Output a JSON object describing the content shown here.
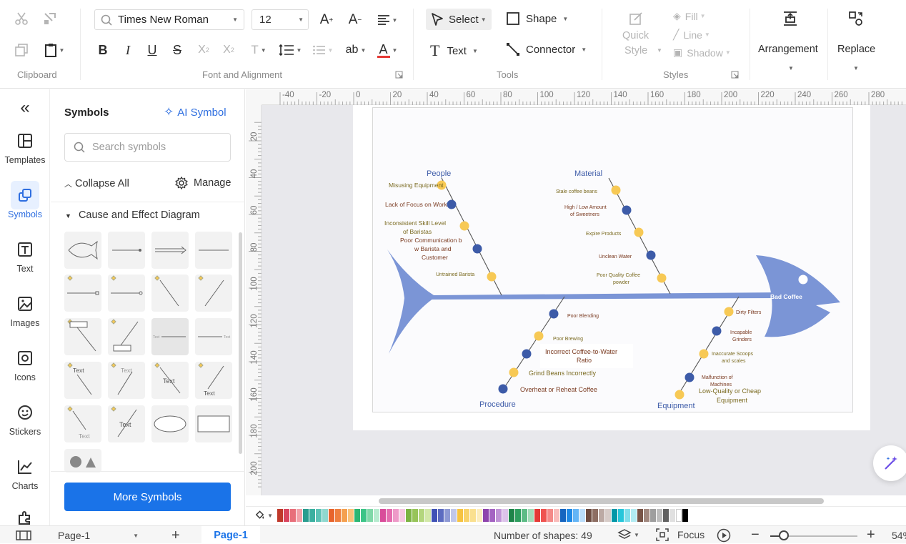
{
  "ribbon": {
    "font_name": "Times New Roman",
    "font_size": "12",
    "groups": {
      "clipboard": "Clipboard",
      "font_alignment": "Font and Alignment",
      "tools": "Tools",
      "styles": "Styles"
    },
    "tools": {
      "select": "Select",
      "shape": "Shape",
      "text": "Text",
      "connector": "Connector"
    },
    "styles": {
      "quick": "Quick",
      "style": "Style",
      "fill": "Fill",
      "line": "Line",
      "shadow": "Shadow"
    },
    "arrangement": "Arrangement",
    "replace": "Replace"
  },
  "rail": {
    "templates": "Templates",
    "symbols": "Symbols",
    "text": "Text",
    "images": "Images",
    "icons": "Icons",
    "stickers": "Stickers",
    "charts": "Charts"
  },
  "panel": {
    "title": "Symbols",
    "ai_symbol": "AI Symbol",
    "search_placeholder": "Search symbols",
    "collapse_all": "Collapse All",
    "manage": "Manage",
    "category": "Cause and Effect Diagram",
    "more_symbols": "More Symbols",
    "sym_text": "Text"
  },
  "rulers": {
    "h": [
      "-40",
      "-20",
      "0",
      "20",
      "40",
      "60",
      "80",
      "100",
      "120",
      "140",
      "160",
      "180",
      "200",
      "220",
      "240",
      "260",
      "280"
    ],
    "v": [
      "20",
      "40",
      "60",
      "80",
      "100",
      "120",
      "140",
      "160",
      "180",
      "200"
    ]
  },
  "diagram": {
    "head_label": "Bad Coffee",
    "categories": {
      "people": "People",
      "material": "Material",
      "procedure": "Procedure",
      "equipment": "Equipment"
    },
    "people_causes": [
      "Misusing Equipment",
      "Lack of Focus on Work",
      "Inconsistent Skill Level",
      "of Baristas",
      "Poor Communication b",
      "w Barista and",
      "Customer",
      "Untrained Barista"
    ],
    "material_causes": [
      "Stale coffee beans",
      "High / Low Amount",
      "of Sweetners",
      "Expire Products",
      "Unclean Water",
      "Poor Quality Coffee",
      "powder"
    ],
    "procedure_causes": [
      "Poor Blending",
      "Poor Brewing",
      "Incorrect Coffee-to-Water",
      "Ratio",
      "Grind Beans Incorrectly",
      "Overheat or Reheat Coffee"
    ],
    "equipment_causes": [
      "Dirty Filters",
      "Incapable",
      "Grinders",
      "Inaccurate Scoops",
      "and scales",
      "Malfunction  of",
      "Machines",
      "Low-Quality or Cheap",
      "Equipment"
    ]
  },
  "status": {
    "page_dropdown": "Page-1",
    "page_tab": "Page-1",
    "shapes": "Number of shapes: 49",
    "focus": "Focus",
    "zoom": "54%"
  },
  "colors": {
    "accent": "#1a73e8",
    "fish": "#7b95d6",
    "dot_yellow": "#f7c955",
    "dot_blue": "#3d5ba8"
  }
}
